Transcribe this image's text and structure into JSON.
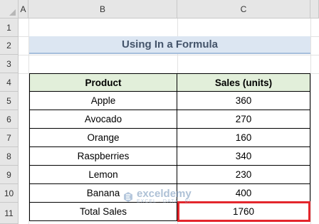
{
  "columns": [
    "A",
    "B",
    "C"
  ],
  "rows": [
    "1",
    "2",
    "3",
    "4",
    "5",
    "6",
    "7",
    "8",
    "9",
    "10",
    "11"
  ],
  "title": "Using In a Formula",
  "table": {
    "headers": [
      "Product",
      "Sales (units)"
    ],
    "rows": [
      {
        "product": "Apple",
        "sales": "360"
      },
      {
        "product": "Avocado",
        "sales": "270"
      },
      {
        "product": "Orange",
        "sales": "160"
      },
      {
        "product": "Raspberries",
        "sales": "340"
      },
      {
        "product": "Lemon",
        "sales": "230"
      },
      {
        "product": "Banana",
        "sales": "400"
      }
    ],
    "total": {
      "label": "Total Sales",
      "value": "1760"
    }
  },
  "watermark": {
    "name": "exceldemy",
    "tagline": "EXCEL · DATA · BI"
  },
  "colors": {
    "title_fill": "#dce6f2",
    "header_fill": "#e2efda",
    "highlight": "#e3262c"
  }
}
